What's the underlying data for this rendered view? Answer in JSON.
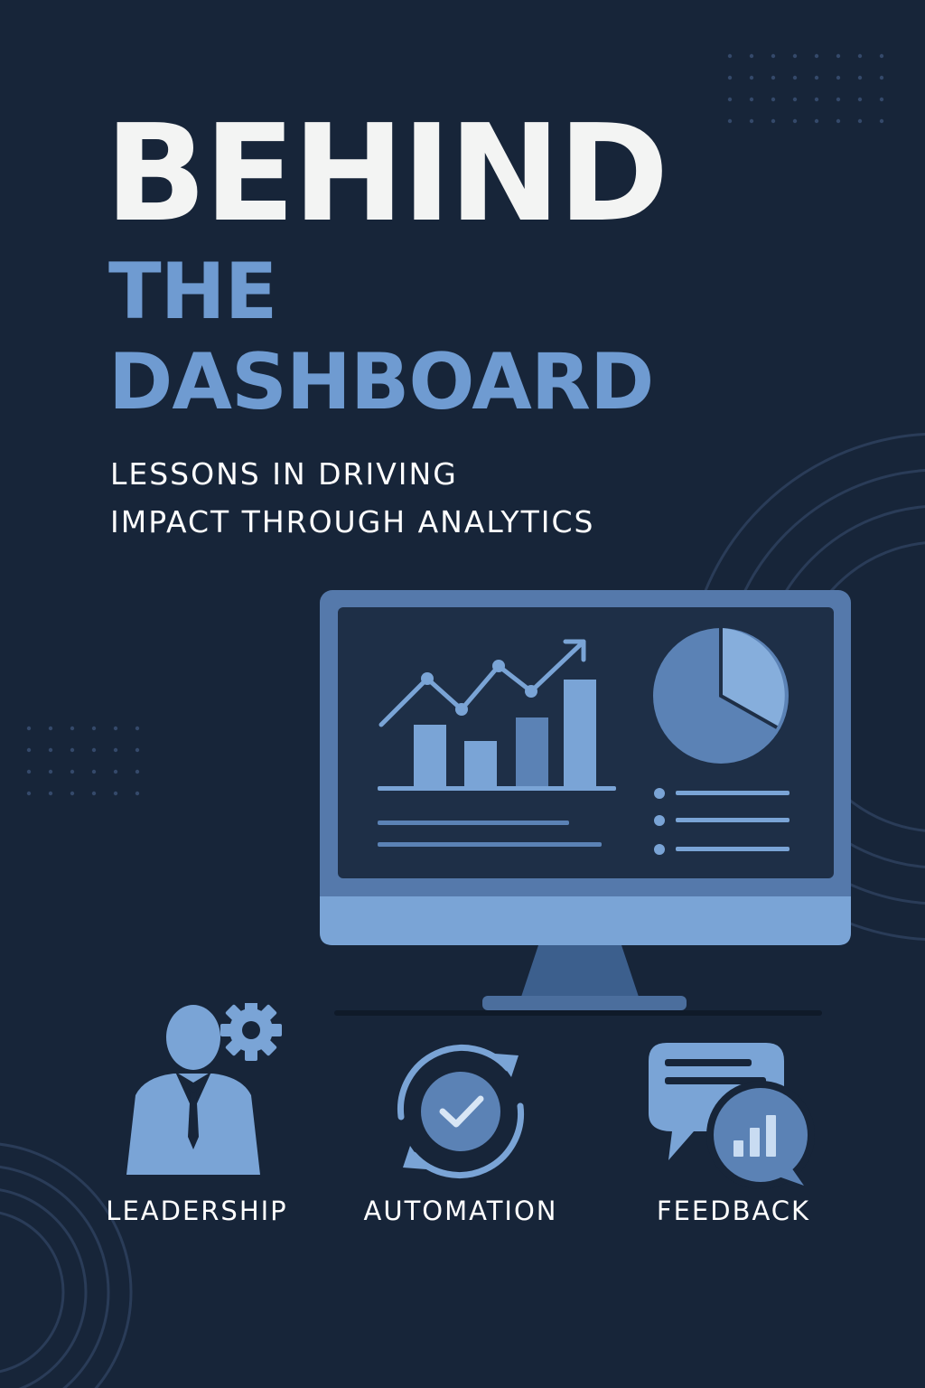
{
  "title": {
    "line1": "BEHIND",
    "line2": "THE",
    "line3": "DASHBOARD"
  },
  "subtitle": {
    "line1": "LESSONS IN DRIVING",
    "line2": "IMPACT THROUGH ANALYTICS"
  },
  "features": [
    {
      "label": "LEADERSHIP",
      "icon": "leader-gear-icon"
    },
    {
      "label": "AUTOMATION",
      "icon": "cycle-check-icon"
    },
    {
      "label": "FEEDBACK",
      "icon": "chat-bars-icon"
    }
  ],
  "colors": {
    "background": "#172539",
    "title_white": "#f3f4f3",
    "title_blue": "#6f9bd1",
    "accent_light": "#7aa4d6",
    "accent_mid": "#5b82b5",
    "accent_dark": "#3c5f8d"
  }
}
